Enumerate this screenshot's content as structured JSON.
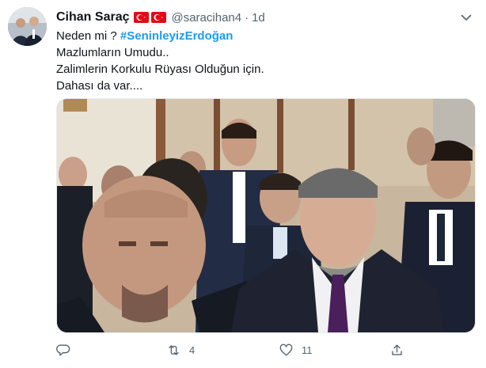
{
  "tweet": {
    "display_name": "Cihan Saraç",
    "handle": "@saracihan4",
    "separator": "·",
    "time": "1d",
    "lines": {
      "prefix": "Neden mi ?",
      "hashtag": "#SeninleyizErdoğan",
      "line2": "Mazlumların Umudu..",
      "line3": "Zalimlerin Korkulu Rüyası Olduğun için.",
      "line4": "Dahası da var...."
    },
    "stats": {
      "retweets": "4",
      "likes": "11"
    }
  },
  "icons": {
    "avatar": "avatar-photo",
    "flags": [
      "turkey-flag-icon",
      "turkey-flag-icon"
    ],
    "more": "chevron-down-icon",
    "reply": "reply-icon",
    "retweet": "retweet-icon",
    "like": "heart-icon",
    "share": "share-icon"
  },
  "colors": {
    "accent": "#1d9bf0",
    "muted": "#536471",
    "text": "#0f1419",
    "flag_red": "#e30a17"
  }
}
